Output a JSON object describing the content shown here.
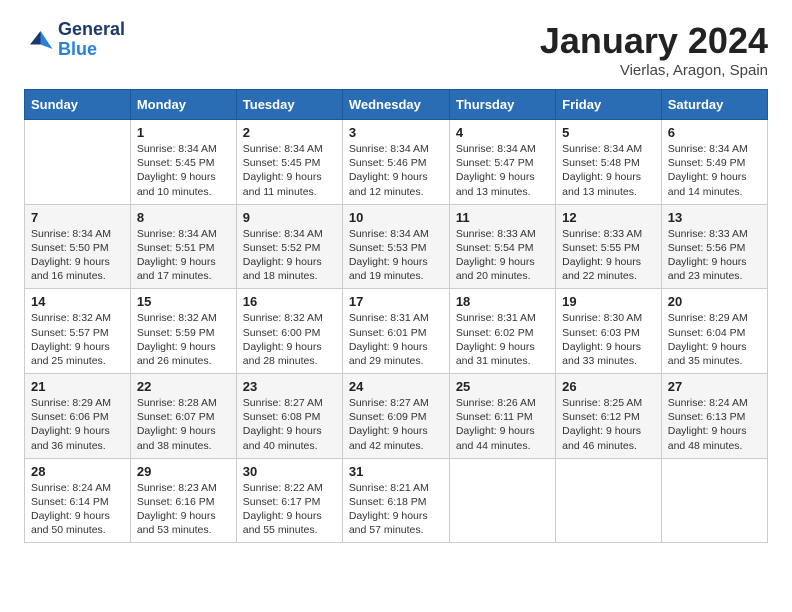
{
  "header": {
    "logo_general": "General",
    "logo_blue": "Blue",
    "month_title": "January 2024",
    "subtitle": "Vierlas, Aragon, Spain"
  },
  "days_of_week": [
    "Sunday",
    "Monday",
    "Tuesday",
    "Wednesday",
    "Thursday",
    "Friday",
    "Saturday"
  ],
  "weeks": [
    [
      {
        "day": "",
        "info": ""
      },
      {
        "day": "1",
        "info": "Sunrise: 8:34 AM\nSunset: 5:45 PM\nDaylight: 9 hours\nand 10 minutes."
      },
      {
        "day": "2",
        "info": "Sunrise: 8:34 AM\nSunset: 5:45 PM\nDaylight: 9 hours\nand 11 minutes."
      },
      {
        "day": "3",
        "info": "Sunrise: 8:34 AM\nSunset: 5:46 PM\nDaylight: 9 hours\nand 12 minutes."
      },
      {
        "day": "4",
        "info": "Sunrise: 8:34 AM\nSunset: 5:47 PM\nDaylight: 9 hours\nand 13 minutes."
      },
      {
        "day": "5",
        "info": "Sunrise: 8:34 AM\nSunset: 5:48 PM\nDaylight: 9 hours\nand 13 minutes."
      },
      {
        "day": "6",
        "info": "Sunrise: 8:34 AM\nSunset: 5:49 PM\nDaylight: 9 hours\nand 14 minutes."
      }
    ],
    [
      {
        "day": "7",
        "info": "Sunrise: 8:34 AM\nSunset: 5:50 PM\nDaylight: 9 hours\nand 16 minutes."
      },
      {
        "day": "8",
        "info": "Sunrise: 8:34 AM\nSunset: 5:51 PM\nDaylight: 9 hours\nand 17 minutes."
      },
      {
        "day": "9",
        "info": "Sunrise: 8:34 AM\nSunset: 5:52 PM\nDaylight: 9 hours\nand 18 minutes."
      },
      {
        "day": "10",
        "info": "Sunrise: 8:34 AM\nSunset: 5:53 PM\nDaylight: 9 hours\nand 19 minutes."
      },
      {
        "day": "11",
        "info": "Sunrise: 8:33 AM\nSunset: 5:54 PM\nDaylight: 9 hours\nand 20 minutes."
      },
      {
        "day": "12",
        "info": "Sunrise: 8:33 AM\nSunset: 5:55 PM\nDaylight: 9 hours\nand 22 minutes."
      },
      {
        "day": "13",
        "info": "Sunrise: 8:33 AM\nSunset: 5:56 PM\nDaylight: 9 hours\nand 23 minutes."
      }
    ],
    [
      {
        "day": "14",
        "info": "Sunrise: 8:32 AM\nSunset: 5:57 PM\nDaylight: 9 hours\nand 25 minutes."
      },
      {
        "day": "15",
        "info": "Sunrise: 8:32 AM\nSunset: 5:59 PM\nDaylight: 9 hours\nand 26 minutes."
      },
      {
        "day": "16",
        "info": "Sunrise: 8:32 AM\nSunset: 6:00 PM\nDaylight: 9 hours\nand 28 minutes."
      },
      {
        "day": "17",
        "info": "Sunrise: 8:31 AM\nSunset: 6:01 PM\nDaylight: 9 hours\nand 29 minutes."
      },
      {
        "day": "18",
        "info": "Sunrise: 8:31 AM\nSunset: 6:02 PM\nDaylight: 9 hours\nand 31 minutes."
      },
      {
        "day": "19",
        "info": "Sunrise: 8:30 AM\nSunset: 6:03 PM\nDaylight: 9 hours\nand 33 minutes."
      },
      {
        "day": "20",
        "info": "Sunrise: 8:29 AM\nSunset: 6:04 PM\nDaylight: 9 hours\nand 35 minutes."
      }
    ],
    [
      {
        "day": "21",
        "info": "Sunrise: 8:29 AM\nSunset: 6:06 PM\nDaylight: 9 hours\nand 36 minutes."
      },
      {
        "day": "22",
        "info": "Sunrise: 8:28 AM\nSunset: 6:07 PM\nDaylight: 9 hours\nand 38 minutes."
      },
      {
        "day": "23",
        "info": "Sunrise: 8:27 AM\nSunset: 6:08 PM\nDaylight: 9 hours\nand 40 minutes."
      },
      {
        "day": "24",
        "info": "Sunrise: 8:27 AM\nSunset: 6:09 PM\nDaylight: 9 hours\nand 42 minutes."
      },
      {
        "day": "25",
        "info": "Sunrise: 8:26 AM\nSunset: 6:11 PM\nDaylight: 9 hours\nand 44 minutes."
      },
      {
        "day": "26",
        "info": "Sunrise: 8:25 AM\nSunset: 6:12 PM\nDaylight: 9 hours\nand 46 minutes."
      },
      {
        "day": "27",
        "info": "Sunrise: 8:24 AM\nSunset: 6:13 PM\nDaylight: 9 hours\nand 48 minutes."
      }
    ],
    [
      {
        "day": "28",
        "info": "Sunrise: 8:24 AM\nSunset: 6:14 PM\nDaylight: 9 hours\nand 50 minutes."
      },
      {
        "day": "29",
        "info": "Sunrise: 8:23 AM\nSunset: 6:16 PM\nDaylight: 9 hours\nand 53 minutes."
      },
      {
        "day": "30",
        "info": "Sunrise: 8:22 AM\nSunset: 6:17 PM\nDaylight: 9 hours\nand 55 minutes."
      },
      {
        "day": "31",
        "info": "Sunrise: 8:21 AM\nSunset: 6:18 PM\nDaylight: 9 hours\nand 57 minutes."
      },
      {
        "day": "",
        "info": ""
      },
      {
        "day": "",
        "info": ""
      },
      {
        "day": "",
        "info": ""
      }
    ]
  ]
}
